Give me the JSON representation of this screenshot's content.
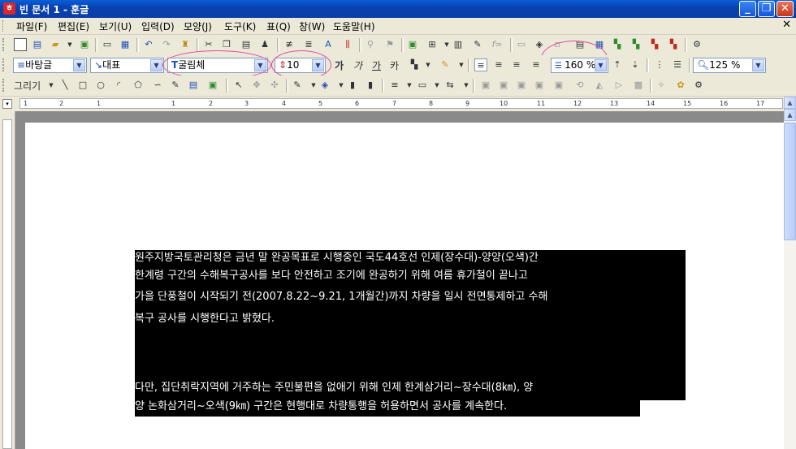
{
  "window": {
    "title": "빈 문서 1 - 훈글",
    "app_icon": "ㅎ",
    "minimize": "_",
    "maximize": "❐",
    "close": "✕"
  },
  "menu": [
    "파일(F)",
    "편집(E)",
    "보기(U)",
    "입력(D)",
    "모양(J)",
    "도구(K)",
    "표(Q)",
    "창(W)",
    "도움말(H)"
  ],
  "format_bar": {
    "style": "바탕글",
    "paragraph_shape": "대표",
    "font": "굴림체",
    "size": "10",
    "bold": "가",
    "italic": "가",
    "underline": "가",
    "superscript": "카",
    "line_spacing": "160 %",
    "zoom": "125 %"
  },
  "draw_bar": {
    "label": "그리기"
  },
  "ruler": {
    "ticks": [
      "1",
      "2",
      "1",
      "1",
      "2",
      "3",
      "4",
      "5",
      "6",
      "7",
      "8",
      "9",
      "10",
      "11",
      "12",
      "13",
      "14",
      "15",
      "16",
      "17"
    ]
  },
  "document": {
    "lines": [
      "원주지방국토관리청은 금년 말 완공목표로 시행중인 국도44호선 인제(장수대)-양양(오색)간",
      "한계령 구간의 수해복구공사를 보다 안전하고 조기에 완공하기 위해 여름 휴가철이 끝나고",
      "가을 단풍철이 시작되기 전(2007.8.22~9.21, 1개월간)까지 차량을 일시 전면통제하고 수해",
      "복구 공사를 시행한다고 밝혔다.",
      "다만, 집단취락지역에 거주하는 주민불편을 없애기 위해 인제 한계삼거리~장수대(8㎞), 양",
      "양 논화삼거리~오색(9㎞) 구간은 현행대로 차량통행을 허용하면서 공사를 계속한다."
    ]
  },
  "colors": {
    "highlight_circle": "#e04aa5",
    "selection_bg": "#000000",
    "selection_fg": "#ffffff"
  }
}
